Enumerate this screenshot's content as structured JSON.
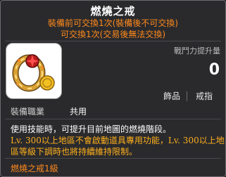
{
  "item": {
    "name": "燃燒之戒",
    "trade_line_1": "裝備前可交換1次(裝備後不可交換)",
    "trade_line_2": "可交換1次(交易後無法交換)",
    "icon": "burning-ring-icon"
  },
  "stats": {
    "combat_power_label": "戰鬥力提升量",
    "combat_power_value": "0"
  },
  "tags": [
    "飾品",
    "戒指"
  ],
  "requirement": {
    "job_label": "裝備職業",
    "job_value": "共用"
  },
  "description": [
    "使用技能時，可提升目前地圖的燃燒階段。",
    "Lv. 300以上地區不會啟動道具專用功能，Lv. 300以上地",
    "區等級下調時也將持續維持限制。"
  ],
  "set_info": "燃燒之戒1級",
  "colors": {
    "background": "#2a2a2d",
    "border": "#6b6b70",
    "trade_text": "#ff8a1c",
    "description_highlight": "#ffb01c"
  }
}
